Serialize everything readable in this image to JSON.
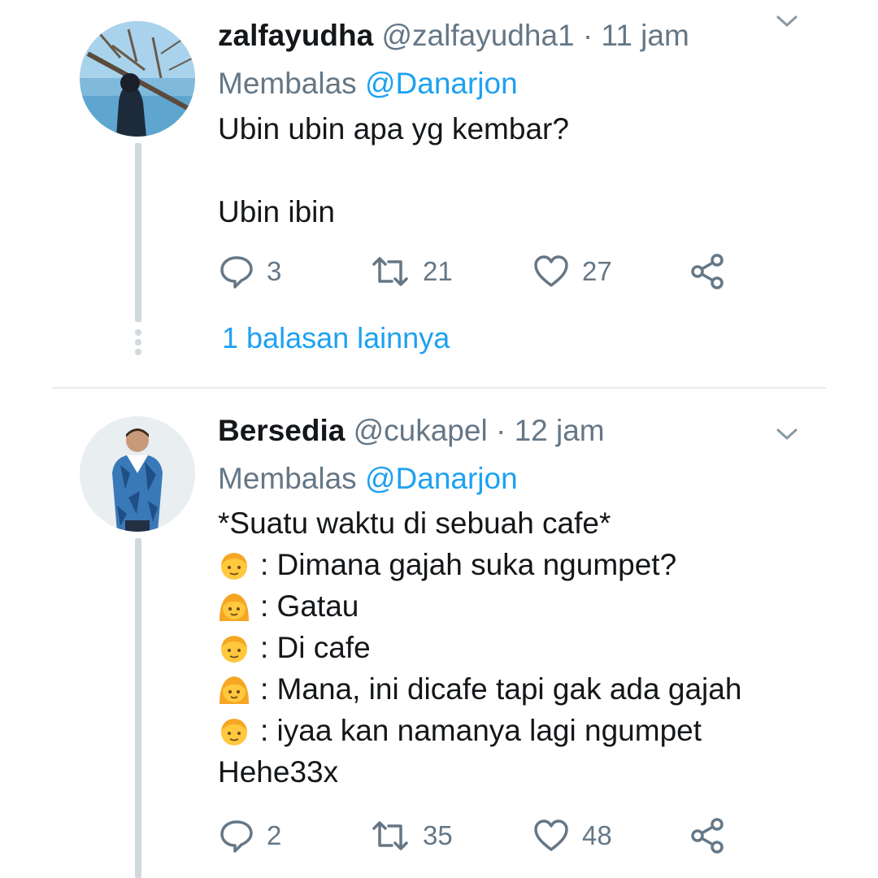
{
  "tweets": [
    {
      "name": "zalfayudha",
      "handle": "@zalfayudha1",
      "time": "· 11 jam",
      "replying_prefix": "Membalas",
      "replying_to": "@Danarjon",
      "lines": [
        "Ubin ubin apa yg kembar?",
        "",
        "Ubin ibin"
      ],
      "replies": "3",
      "retweets": "21",
      "likes": "27",
      "more_replies": "1 balasan lainnya"
    },
    {
      "name": "Bersedia",
      "handle": "@cukapel",
      "time": "· 12 jam",
      "replying_prefix": "Membalas",
      "replying_to": "@Danarjon",
      "lines": [
        {
          "emoji": "",
          "text": "*Suatu waktu di sebuah cafe*"
        },
        {
          "emoji": "boy-face",
          "text": ": Dimana gajah suka ngumpet?"
        },
        {
          "emoji": "girl-face",
          "text": ": Gatau"
        },
        {
          "emoji": "boy-face",
          "text": ": Di cafe"
        },
        {
          "emoji": "girl-face",
          "text": ": Mana, ini dicafe tapi gak ada gajah"
        },
        {
          "emoji": "boy-face",
          "text": ": iyaa kan namanya lagi ngumpet"
        },
        {
          "emoji": "",
          "text": "Hehe33x"
        }
      ],
      "replies": "2",
      "retweets": "35",
      "likes": "48"
    }
  ],
  "colors": {
    "accent": "#1da1f2",
    "secondary": "#657786",
    "thread": "#cfd9de",
    "divider": "#e6ecf0"
  }
}
